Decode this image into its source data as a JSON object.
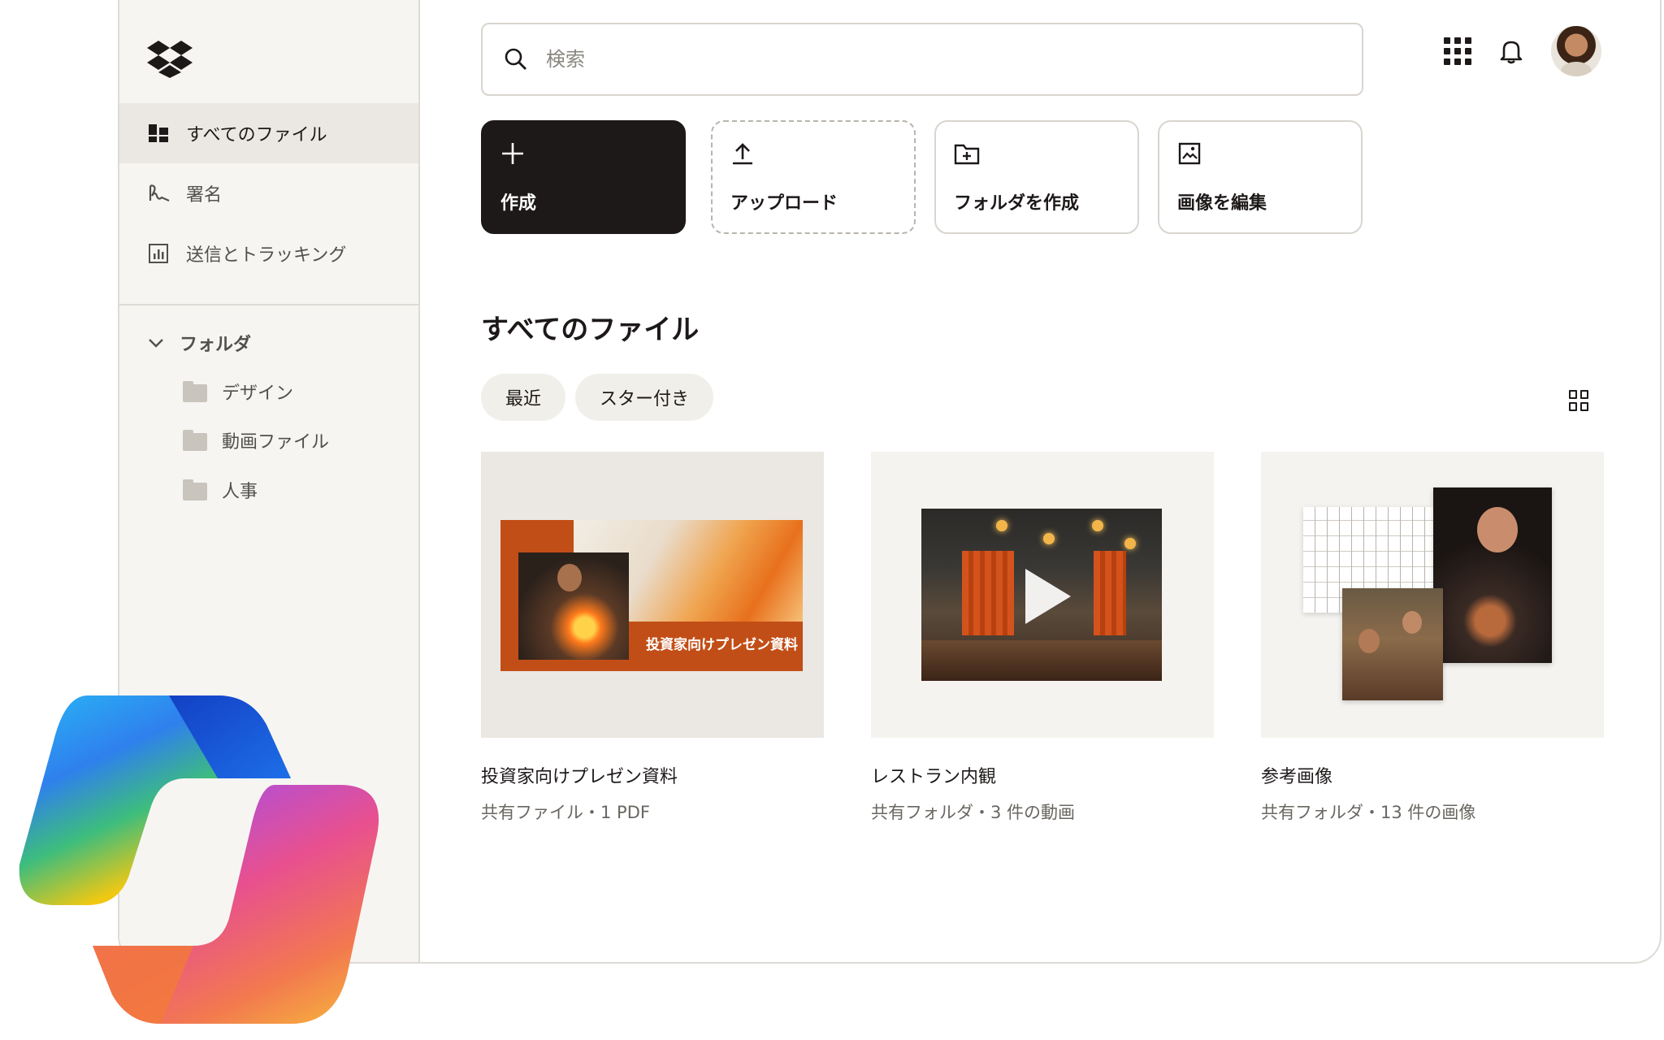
{
  "sidebar": {
    "nav": [
      {
        "label": "すべてのファイル",
        "icon": "files-icon",
        "active": true
      },
      {
        "label": "署名",
        "icon": "signature-icon",
        "active": false
      },
      {
        "label": "送信とトラッキング",
        "icon": "chart-icon",
        "active": false
      }
    ],
    "folder_heading": "フォルダ",
    "folders": [
      "デザイン",
      "動画ファイル",
      "人事"
    ]
  },
  "search": {
    "placeholder": "検索",
    "value": ""
  },
  "actions": [
    {
      "label": "作成",
      "icon": "plus-icon"
    },
    {
      "label": "アップロード",
      "icon": "upload-icon"
    },
    {
      "label": "フォルダを作成",
      "icon": "folder-plus-icon"
    },
    {
      "label": "画像を編集",
      "icon": "image-edit-icon"
    }
  ],
  "main": {
    "title": "すべてのファイル",
    "chips": [
      "最近",
      "スター付き"
    ],
    "cards": [
      {
        "title": "投資家向けプレゼン資料",
        "subtitle": "共有ファイル・1 PDF",
        "thumb_caption": "投資家向けプレゼン資料"
      },
      {
        "title": "レストラン内観",
        "subtitle": "共有フォルダ・3 件の動画"
      },
      {
        "title": "参考画像",
        "subtitle": "共有フォルダ・13 件の画像"
      }
    ]
  },
  "colors": {
    "accent_dark": "#1e1919",
    "sidebar_bg": "#f7f5f2",
    "slide_orange": "#c24e17"
  }
}
